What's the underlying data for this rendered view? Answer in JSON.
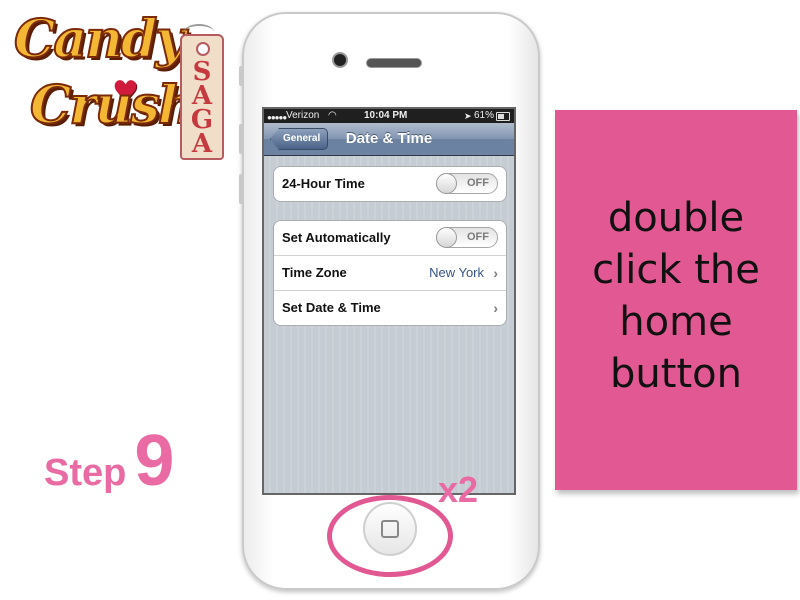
{
  "logo": {
    "candy_text": "Candy",
    "crush_text": "Crush",
    "saga_text": "SAGA"
  },
  "step": {
    "label": "Step",
    "number": "9"
  },
  "instruction": {
    "line1": "double",
    "line2": "click the",
    "line3": "home",
    "line4": "button"
  },
  "annotation": {
    "tap_count": "x2"
  },
  "status_bar": {
    "carrier": "Verizon",
    "time": "10:04 PM",
    "battery": "61%"
  },
  "nav": {
    "back_label": "General",
    "title": "Date & Time"
  },
  "settings": {
    "twenty_four_hour": {
      "label": "24-Hour Time",
      "toggle": "OFF"
    },
    "set_automatically": {
      "label": "Set Automatically",
      "toggle": "OFF"
    },
    "time_zone": {
      "label": "Time Zone",
      "value": "New York"
    },
    "set_date_time": {
      "label": "Set Date & Time"
    }
  },
  "colors": {
    "pink_accent": "#e25892",
    "step_pink": "#ea6aa3",
    "ios_value_blue": "#385487"
  }
}
